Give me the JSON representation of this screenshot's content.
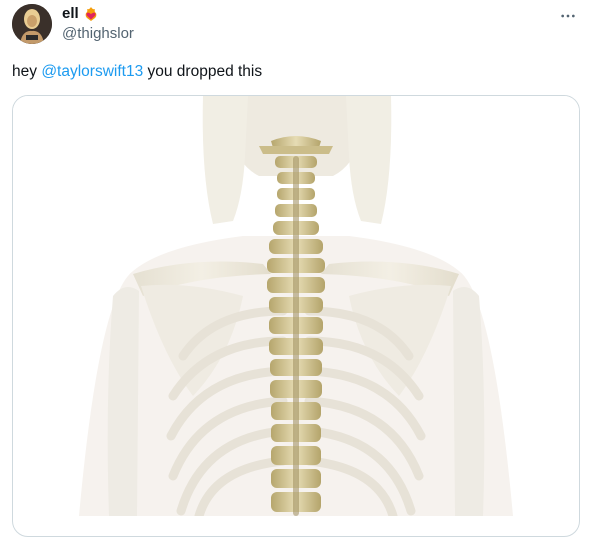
{
  "tweet": {
    "author": {
      "display_name": "ell",
      "handle": "@thighslor",
      "badge_icon": "heart-on-fire-icon"
    },
    "text": {
      "prefix": "hey ",
      "mention": "@taylorswift13",
      "suffix": " you dropped this"
    },
    "more_icon": "more-horizontal-icon",
    "media": {
      "subject": "spine-skeleton-image"
    }
  },
  "colors": {
    "link": "#1d9bf0",
    "secondary_text": "#536471",
    "border": "#cfd9de",
    "bone_light": "#ece8dc",
    "vertebra": "#d4c79a"
  }
}
